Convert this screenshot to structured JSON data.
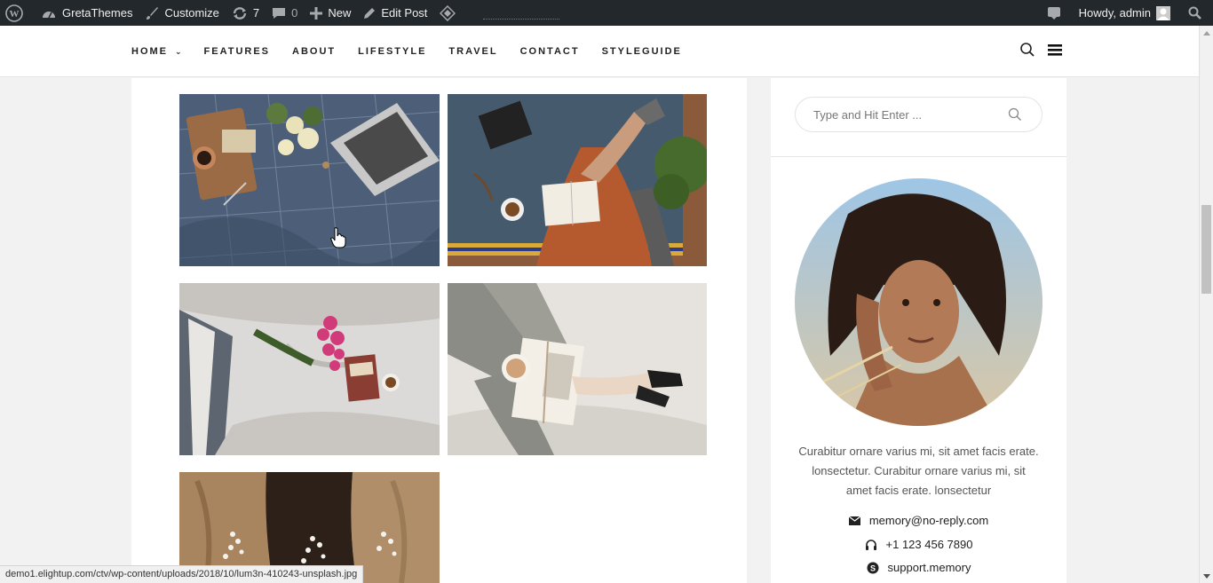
{
  "adminbar": {
    "site_name": "GretaThemes",
    "customize": "Customize",
    "updates_count": "7",
    "comments_count": "0",
    "new_label": "New",
    "edit_post": "Edit Post",
    "howdy": "Howdy, admin"
  },
  "nav": {
    "items": [
      {
        "label": "HOME",
        "has_dropdown": true
      },
      {
        "label": "FEATURES"
      },
      {
        "label": "ABOUT"
      },
      {
        "label": "LIFESTYLE"
      },
      {
        "label": "TRAVEL"
      },
      {
        "label": "CONTACT"
      },
      {
        "label": "STYLEGUIDE"
      }
    ]
  },
  "gallery": {
    "images": [
      {
        "name": "laptop-flowers-bed-photo"
      },
      {
        "name": "reading-book-blanket-photo"
      },
      {
        "name": "pink-flowers-book-bed-photo"
      },
      {
        "name": "coffee-book-socks-photo"
      },
      {
        "name": "three-women-hair-flowers-photo"
      }
    ]
  },
  "sidebar": {
    "search_placeholder": "Type and Hit Enter ...",
    "about_text": "Curabitur ornare varius mi, sit amet facis erate. lonsectetur. Curabitur ornare varius mi, sit amet facis erate. lonsectetur",
    "email": "memory@no-reply.com",
    "phone": "+1 123 456 7890",
    "skype": "support.memory"
  },
  "statusbar": {
    "url": "demo1.elightup.com/ctv/wp-content/uploads/2018/10/lum3n-410243-unsplash.jpg"
  },
  "colors": {
    "adminbar_bg": "#23282d",
    "page_bg": "#f2f2f2",
    "text_dark": "#222222"
  }
}
